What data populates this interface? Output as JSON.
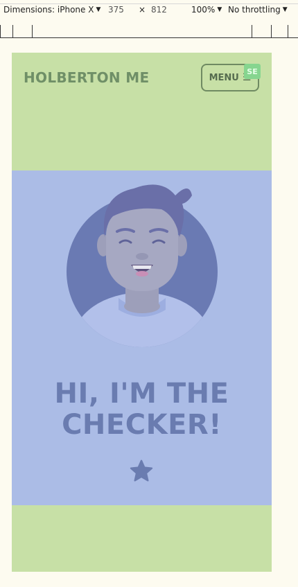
{
  "devtools": {
    "dimensions_label": "Dimensions: iPhone X",
    "width": "375",
    "times": "×",
    "height": "812",
    "zoom": "100%",
    "throttling": "No throttling"
  },
  "site": {
    "brand": "HOLBERTON ME",
    "menu_label": "MENU",
    "menu_icon": "☰",
    "badge_text": "SE"
  },
  "hero": {
    "title_line1": "HI, I'M THE",
    "title_line2": "CHECKER!",
    "avatar_icon": "smiling-person-avatar",
    "star_icon": "star-icon"
  },
  "colors": {
    "page_bg": "#fdfbf0",
    "green_bg": "#c7e0a6",
    "hero_bg": "#abbce6",
    "title_color": "#6a7cb0"
  }
}
